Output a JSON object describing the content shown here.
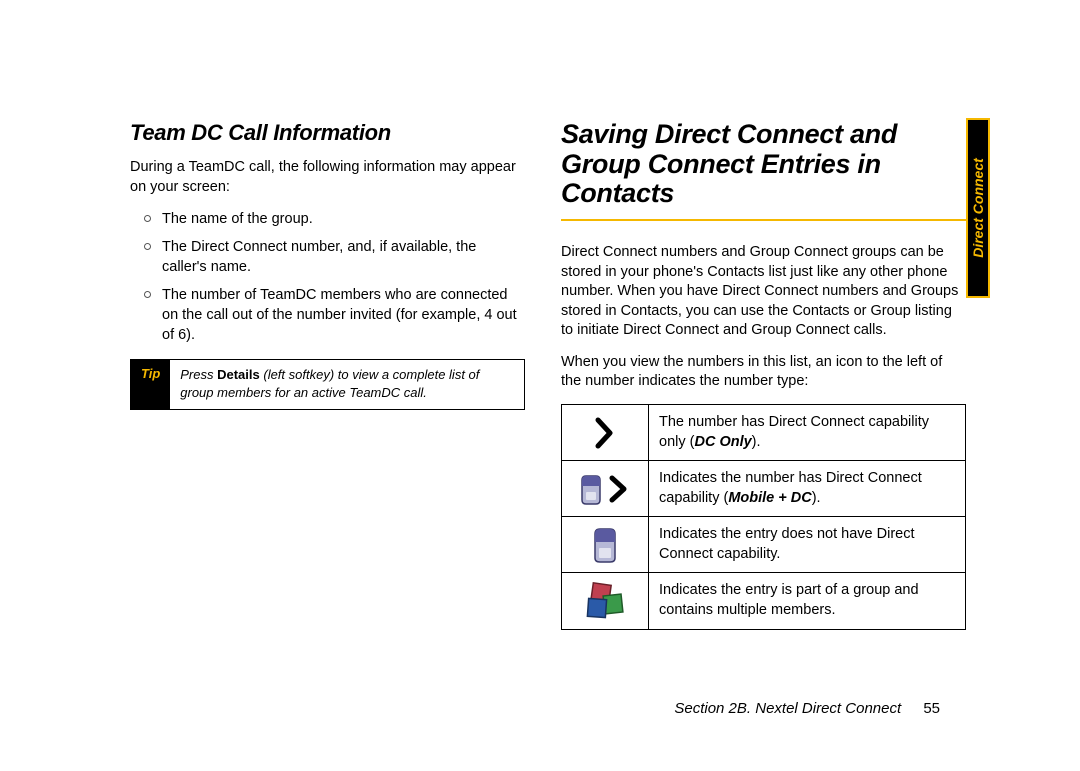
{
  "sideTab": "Direct Connect",
  "left": {
    "heading": "Team DC Call Information",
    "intro": "During a TeamDC call, the following information may appear on your screen:",
    "bullets": [
      "The name of the group.",
      "The Direct Connect number, and, if available, the caller's name.",
      "The number of TeamDC members who are connected on the call out of the number invited (for example, 4 out of 6)."
    ],
    "tip": {
      "label": "Tip",
      "prefix": "Press ",
      "bold": "Details",
      "rest": " (left softkey) to view a complete list of group members for an active TeamDC call."
    }
  },
  "right": {
    "heading": "Saving Direct Connect and Group Connect Entries in Contacts",
    "para1": "Direct Connect numbers and Group Connect groups can be stored in your phone's Contacts list just like any other phone number. When you have Direct Connect numbers and Groups stored in Contacts, you can use the Contacts or Group listing to initiate Direct Connect and Group Connect calls.",
    "para2": "When you view the numbers in this list, an icon to the left of the number indicates the number type:",
    "table": [
      {
        "pre": "The number has Direct Connect capability only (",
        "em": "DC Only",
        "post": ")."
      },
      {
        "pre": "Indicates the number has Direct Connect capability (",
        "em": "Mobile + DC",
        "post": ")."
      },
      {
        "pre": "Indicates the entry does not have Direct Connect capability.",
        "em": "",
        "post": ""
      },
      {
        "pre": "Indicates the entry is part of a group and contains multiple members.",
        "em": "",
        "post": ""
      }
    ]
  },
  "footer": {
    "section": "Section 2B. Nextel Direct Connect",
    "page": "55"
  }
}
